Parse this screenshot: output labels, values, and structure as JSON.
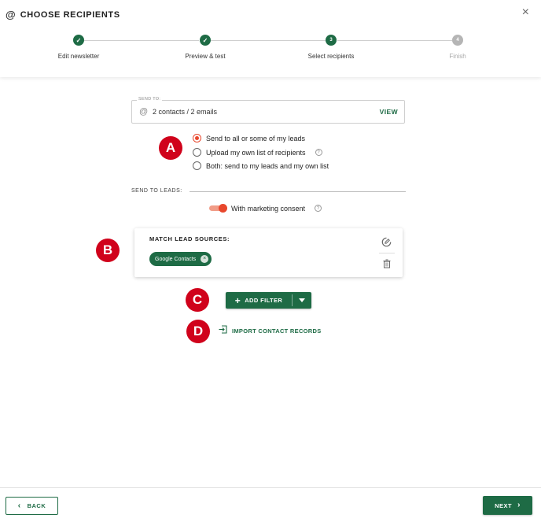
{
  "header": {
    "title": "CHOOSE RECIPIENTS",
    "title_icon": "@",
    "close_icon": "×",
    "steps": [
      {
        "label": "Edit newsletter",
        "state": "done",
        "marker": "✓"
      },
      {
        "label": "Preview & test",
        "state": "done",
        "marker": "✓"
      },
      {
        "label": "Select recipients",
        "state": "current",
        "marker": "3"
      },
      {
        "label": "Finish",
        "state": "pending",
        "marker": "4"
      }
    ]
  },
  "send_to": {
    "legend": "SEND TO:",
    "at_icon": "@",
    "value": "2 contacts / 2 emails",
    "view_label": "VIEW"
  },
  "annotations": {
    "a": "A",
    "b": "B",
    "c": "C",
    "d": "D"
  },
  "recipient_options": [
    {
      "label": "Send to all or some of my leads",
      "selected": true
    },
    {
      "label": "Upload my own list of recipients",
      "selected": false,
      "help": "?"
    },
    {
      "label": "Both: send to my leads and my own list",
      "selected": false
    }
  ],
  "leads": {
    "section_label": "SEND TO LEADS:",
    "consent_label": "With marketing consent",
    "consent_on": true,
    "help": "?"
  },
  "match_card": {
    "title": "MATCH LEAD SOURCES:",
    "chips": [
      {
        "label": "Google Contacts",
        "remove": "×"
      }
    ]
  },
  "add_filter": {
    "label": "ADD FILTER",
    "plus": "+"
  },
  "import": {
    "label": "IMPORT CONTACT RECORDS"
  },
  "footer": {
    "back_label": "BACK",
    "next_label": "NEXT",
    "back_chev": "‹",
    "next_chev": "›"
  },
  "colors": {
    "brand_green": "#1e6b45",
    "accent_orange": "#e8472c",
    "annotation_red": "#d0021b"
  }
}
